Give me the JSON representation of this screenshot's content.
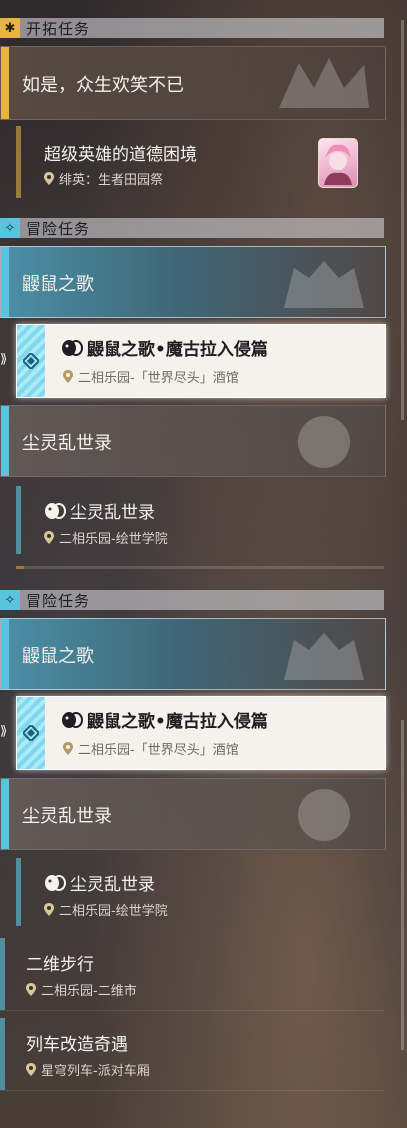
{
  "sections": {
    "trailblaze": {
      "title": "开拓任务",
      "icon": "✱"
    },
    "adventure_1": {
      "title": "冒险任务",
      "icon": "✧"
    },
    "adventure_2": {
      "title": "冒险任务",
      "icon": "✧"
    }
  },
  "trailblaze_category": {
    "label": "如是，众生欢笑不已",
    "accent": "#e9b441"
  },
  "trailblaze_quest": {
    "title": "超级英雄的道德困境",
    "location": "绯英：生者田园祭",
    "avatar": "character-portrait"
  },
  "list1": {
    "cat_a": "鼹鼠之歌",
    "selected": {
      "title": "鼹鼠之歌•魔古拉入侵篇",
      "location": "二相乐园-「世界尽头」酒馆"
    },
    "cat_b": "尘灵乱世录",
    "quest_b": {
      "title": "尘灵乱世录",
      "location": "二相乐园-绘世学院"
    }
  },
  "list2": {
    "cat_a": "鼹鼠之歌",
    "selected": {
      "title": "鼹鼠之歌•魔古拉入侵篇",
      "location": "二相乐园-「世界尽头」酒馆"
    },
    "cat_b": "尘灵乱世录",
    "quest_b": {
      "title": "尘灵乱世录",
      "location": "二相乐园-绘世学院"
    },
    "quest_c": {
      "title": "二维步行",
      "location": "二相乐园-二维市"
    },
    "quest_d": {
      "title": "列车改造奇遇",
      "location": "星穹列车-派对车厢"
    }
  },
  "colors": {
    "gold": "#e9b441",
    "teal": "#58c4e0",
    "bronze": "#9a7a3a"
  }
}
